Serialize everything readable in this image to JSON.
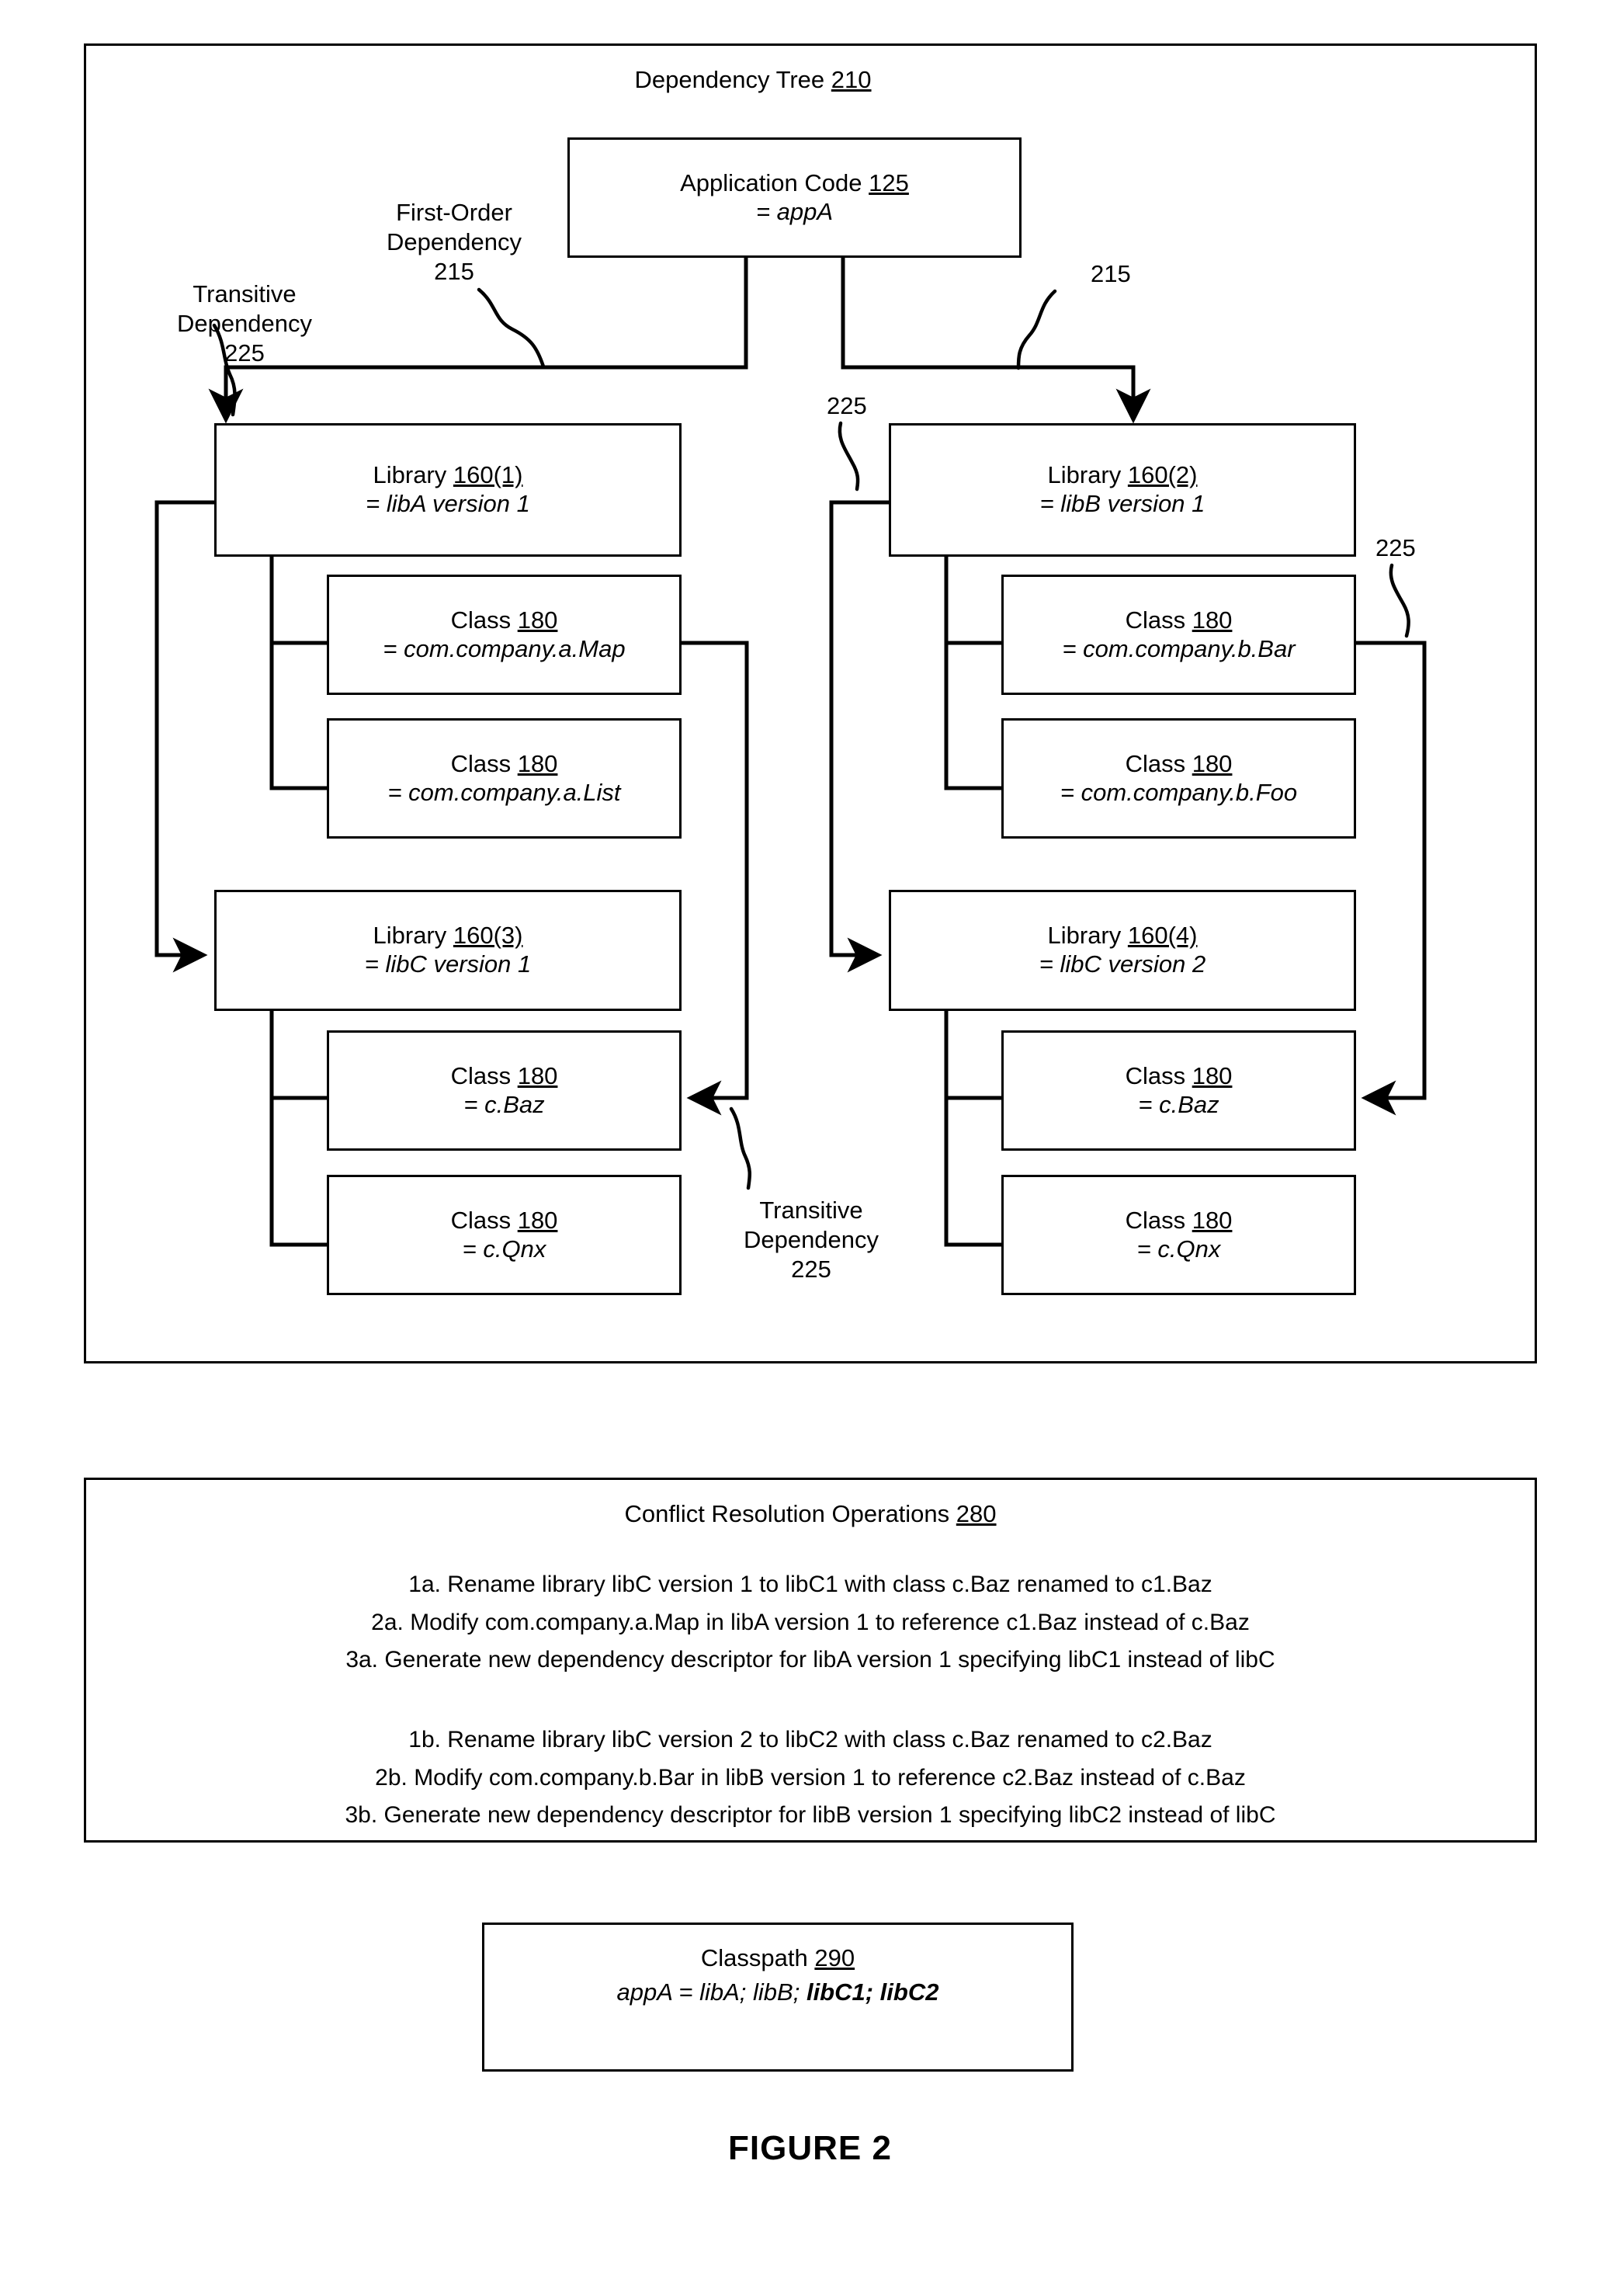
{
  "figure": {
    "label": "FIGURE 2"
  },
  "dependency_tree_panel": {
    "title_text": "Dependency Tree",
    "title_ref": "210",
    "app_node": {
      "line1_text": "Application Code",
      "line1_ref": "125",
      "line2": "= appA"
    },
    "callouts": {
      "first_order": "First-Order\nDependency\n215",
      "transitive_top_left": "Transitive\nDependency\n225",
      "transitive_bottom_mid": "Transitive\nDependency\n225"
    },
    "ref_tags": {
      "first_order_right": "215",
      "transitive_mid_top": "225",
      "transitive_right_top": "225",
      "transitive_right_side": "225"
    },
    "left_column": [
      {
        "kind": "library",
        "line1_text": "Library",
        "line1_ref": "160(1)",
        "line2": "= libA version 1"
      },
      {
        "kind": "class",
        "line1_text": "Class",
        "line1_ref": "180",
        "line2": "= com.company.a.Map"
      },
      {
        "kind": "class",
        "line1_text": "Class",
        "line1_ref": "180",
        "line2": "= com.company.a.List"
      },
      {
        "kind": "library",
        "line1_text": "Library",
        "line1_ref": "160(3)",
        "line2": "= libC version 1"
      },
      {
        "kind": "class",
        "line1_text": "Class",
        "line1_ref": "180",
        "line2": "= c.Baz"
      },
      {
        "kind": "class",
        "line1_text": "Class",
        "line1_ref": "180",
        "line2": "= c.Qnx"
      }
    ],
    "right_column": [
      {
        "kind": "library",
        "line1_text": "Library",
        "line1_ref": "160(2)",
        "line2": "= libB version 1"
      },
      {
        "kind": "class",
        "line1_text": "Class",
        "line1_ref": "180",
        "line2": "= com.company.b.Bar"
      },
      {
        "kind": "class",
        "line1_text": "Class",
        "line1_ref": "180",
        "line2": "= com.company.b.Foo"
      },
      {
        "kind": "library",
        "line1_text": "Library",
        "line1_ref": "160(4)",
        "line2": "= libC version 2"
      },
      {
        "kind": "class",
        "line1_text": "Class",
        "line1_ref": "180",
        "line2": "= c.Baz"
      },
      {
        "kind": "class",
        "line1_text": "Class",
        "line1_ref": "180",
        "line2": "= c.Qnx"
      }
    ]
  },
  "conflict_panel": {
    "title_text": "Conflict Resolution Operations",
    "title_ref": "280",
    "group_a": "1a. Rename library libC version 1 to libC1 with class c.Baz renamed to c1.Baz\n2a. Modify com.company.a.Map in libA version 1 to reference c1.Baz instead of c.Baz\n3a. Generate new dependency descriptor for libA version 1 specifying libC1 instead of libC",
    "group_b": "1b. Rename library libC version 2 to libC2 with class c.Baz renamed to c2.Baz\n2b. Modify com.company.b.Bar in libB version 1 to reference c2.Baz instead of c.Baz\n3b. Generate new dependency descriptor for libB version 1 specifying libC2 instead of libC"
  },
  "classpath_panel": {
    "title_text": "Classpath",
    "title_ref": "290",
    "value_prefix": "appA = libA; libB; ",
    "value_bold": "libC1; libC2"
  },
  "colors": {
    "ink": "#000000",
    "paper": "#ffffff"
  }
}
